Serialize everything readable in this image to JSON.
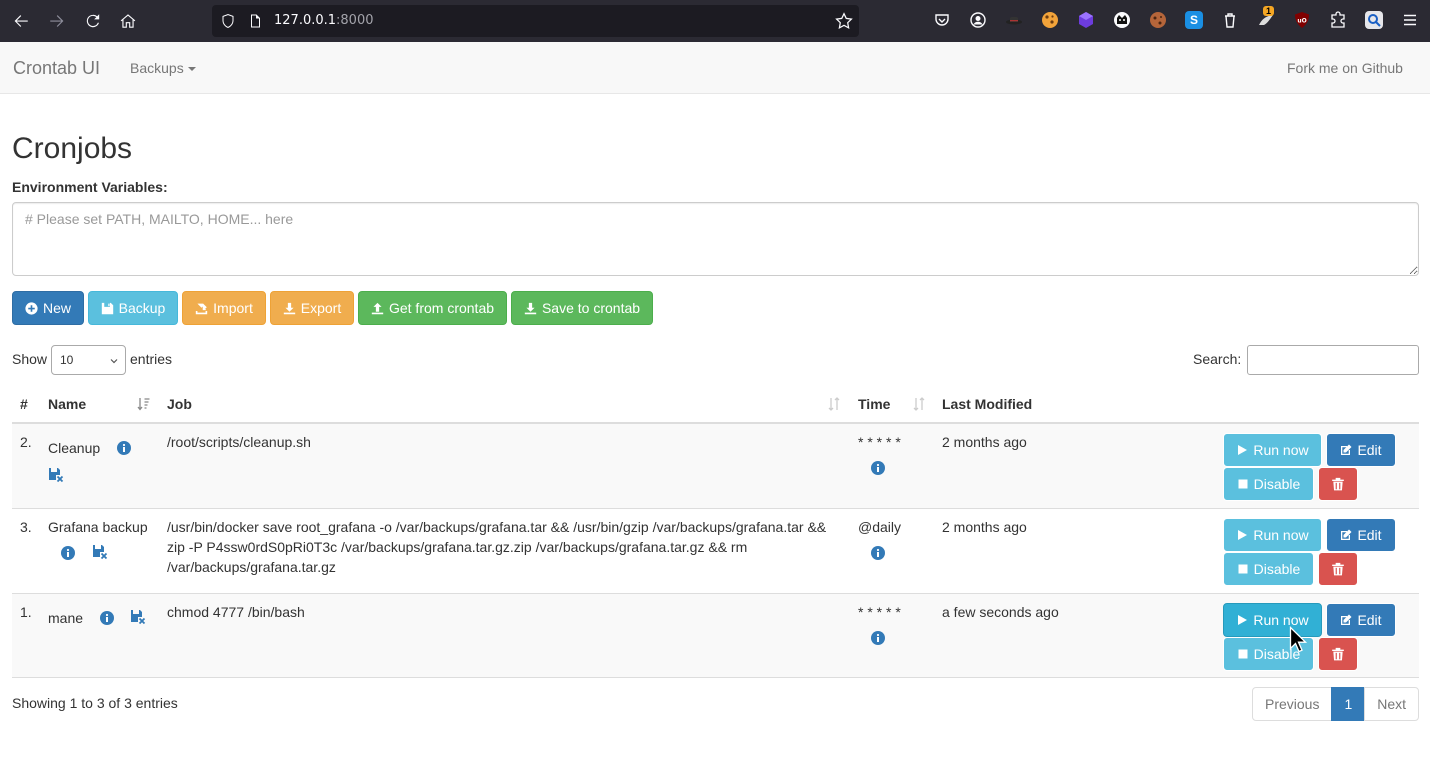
{
  "browser": {
    "url_host": "127.0.0.1",
    "url_port": ":8000",
    "ext_badge": "1"
  },
  "navbar": {
    "brand": "Crontab UI",
    "dropdown": "Backups",
    "right_link": "Fork me on Github"
  },
  "main": {
    "title": "Cronjobs",
    "env_label": "Environment Variables:",
    "env_placeholder": "# Please set PATH, MAILTO, HOME... here"
  },
  "toolbar": {
    "new_label": "New",
    "backup_label": "Backup",
    "import_label": "Import",
    "export_label": "Export",
    "get_label": "Get from crontab",
    "save_label": "Save to crontab"
  },
  "table_controls": {
    "show_label": "Show",
    "length_value": "10",
    "entries_label": "entries",
    "search_label": "Search:"
  },
  "table": {
    "headers": {
      "num": "#",
      "name": "Name",
      "job": "Job",
      "time": "Time",
      "modified": "Last Modified"
    },
    "rows": [
      {
        "num": "2.",
        "name": "Cleanup",
        "job": "/root/scripts/cleanup.sh",
        "time": "* * * * *",
        "modified": "2 months ago",
        "disable_label": "Disable"
      },
      {
        "num": "3.",
        "name": "Grafana backup",
        "job": "/usr/bin/docker save root_grafana -o /var/backups/grafana.tar && /usr/bin/gzip /var/backups/grafana.tar && zip -P P4ssw0rdS0pRi0T3c /var/backups/grafana.tar.gz.zip /var/backups/grafana.tar.gz && rm /var/backups/grafana.tar.gz",
        "time": "@daily",
        "modified": "2 months ago",
        "disable_label": "Disable"
      },
      {
        "num": "1.",
        "name": "mane",
        "job": "chmod 4777 /bin/bash",
        "time": "* * * * *",
        "modified": "a few seconds ago",
        "disable_label": "Disable"
      }
    ],
    "run_label": "Run now",
    "edit_label": "Edit"
  },
  "footer": {
    "info": "Showing 1 to 3 of 3 entries",
    "prev": "Previous",
    "page": "1",
    "next": "Next"
  },
  "colors": {
    "primary": "#337ab7",
    "info": "#5bc0de",
    "warning": "#f0ad4e",
    "success": "#5cb85c",
    "danger": "#d9534f"
  }
}
